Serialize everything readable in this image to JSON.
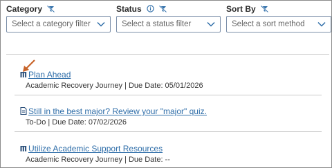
{
  "filters": {
    "category": {
      "label": "Category",
      "placeholder": "Select a category filter"
    },
    "status": {
      "label": "Status",
      "placeholder": "Select a status filter"
    },
    "sort_by": {
      "label": "Sort By",
      "placeholder": "Select a sort method"
    }
  },
  "items": [
    {
      "title": "Plan Ahead",
      "meta": "Academic Recovery Journey |  Due Date: 05/01/2026",
      "icon": "journey-icon"
    },
    {
      "title": "Still in the best major? Review your \"major\" quiz.",
      "meta": "To-Do |  Due Date: 07/02/2026",
      "icon": "todo-document-icon"
    },
    {
      "title": "Utilize Academic Support Resources",
      "meta": "Academic Recovery Journey |  Due Date: --",
      "icon": "journey-icon"
    }
  ],
  "colors": {
    "link": "#2f6ea9",
    "accent": "#2f6ea9",
    "annotation_arrow": "#c8642a"
  }
}
